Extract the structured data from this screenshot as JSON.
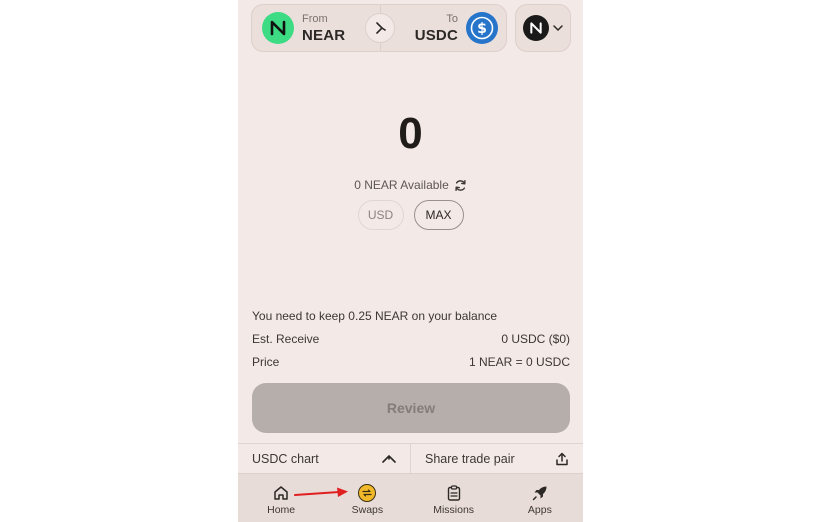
{
  "pair": {
    "from_label": "From",
    "from_symbol": "NEAR",
    "to_label": "To",
    "to_symbol": "USDC",
    "network": "NEAR",
    "icons": [
      "near-logo-icon",
      "swap-direction-icon",
      "usdc-logo-icon",
      "chevron-down-icon"
    ]
  },
  "amount": {
    "value": "0",
    "available": "0 NEAR Available",
    "usd_label": "USD",
    "max_label": "MAX"
  },
  "info": {
    "notice": "You need to keep 0.25 NEAR on your balance",
    "est_receive_label": "Est. Receive",
    "est_receive_value": "0 USDC ($0)",
    "price_label": "Price",
    "price_value": "1 NEAR = 0 USDC"
  },
  "review_label": "Review",
  "actions": {
    "chart_label": "USDC chart",
    "share_label": "Share trade pair"
  },
  "tabs": [
    {
      "label": "Home",
      "icon": "home-icon"
    },
    {
      "label": "Swaps",
      "icon": "swaps-icon"
    },
    {
      "label": "Missions",
      "icon": "clipboard-icon"
    },
    {
      "label": "Apps",
      "icon": "rocket-icon"
    }
  ],
  "colors": {
    "background": "#f3e9e6",
    "near_green": "#3ddc84",
    "usdc_blue": "#2775ca",
    "swaps_active": "#f1b92a",
    "annotation_arrow": "#e02020",
    "review_disabled": "#b5aeab"
  }
}
